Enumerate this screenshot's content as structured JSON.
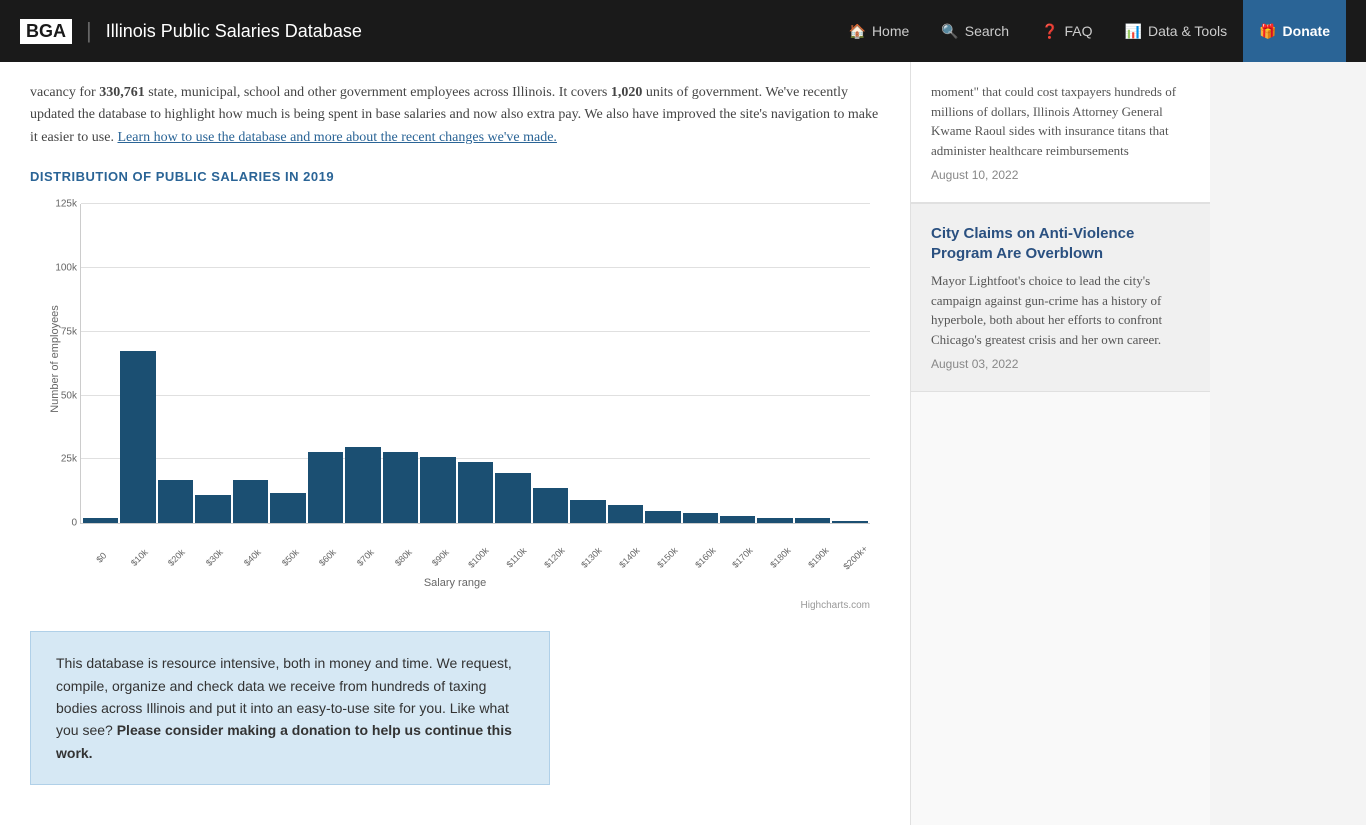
{
  "navbar": {
    "logo": "BGA",
    "divider": "|",
    "title": "Illinois Public Salaries Database",
    "nav_items": [
      {
        "label": "Home",
        "icon": "🏠"
      },
      {
        "label": "Search",
        "icon": "🔍"
      },
      {
        "label": "FAQ",
        "icon": "❓"
      },
      {
        "label": "Data & Tools",
        "icon": "📊"
      },
      {
        "label": "Donate",
        "icon": "🎁"
      }
    ]
  },
  "main": {
    "intro": "vacancy for 330,761 state, municipal, school and other government employees across Illinois. It covers 1,020 units of government. We've recently updated the database to highlight how much is being spent in base salaries and now also extra pay. We also have improved the site's navigation to make it easier to use.",
    "intro_link": "Learn how to use the database and more about the recent changes we've made.",
    "chart_title": "DISTRIBUTION OF PUBLIC SALARIES IN 2019",
    "x_axis_title": "Salary range",
    "y_axis_label": "Number of employees",
    "highcharts_credit": "Highcharts.com",
    "y_labels": [
      "0",
      "25k",
      "50k",
      "75k",
      "100k",
      "125k"
    ],
    "x_labels": [
      "$0",
      "$10k",
      "$20k",
      "$30k",
      "$40k",
      "$50k",
      "$60k",
      "$70k",
      "$80k",
      "$90k",
      "$100k",
      "$110k",
      "$120k",
      "$130k",
      "$140k",
      "$150k",
      "$160k",
      "$170k",
      "$180k",
      "$190k",
      "$200k+"
    ],
    "bar_heights_pct": [
      2,
      68,
      17,
      11,
      17,
      12,
      28,
      30,
      28,
      26,
      24,
      20,
      14,
      9,
      7,
      5,
      4,
      3,
      2,
      2,
      1
    ],
    "donation_box": {
      "text": "This database is resource intensive, both in money and time. We request, compile, organize and check data we receive from hundreds of taxing bodies across Illinois and put it into an easy-to-use site for you. Like what you see?",
      "bold": "Please consider making a donation to help us continue this work."
    }
  },
  "sidebar": {
    "articles": [
      {
        "title": "",
        "body": "moment\" that could cost taxpayers hundreds of millions of dollars, Illinois Attorney General Kwame Raoul sides with insurance titans that administer healthcare reimbursements",
        "date": "August 10, 2022"
      },
      {
        "title": "City Claims on Anti-Violence Program Are Overblown",
        "body": "Mayor Lightfoot's choice to lead the city's campaign against gun-crime has a history of hyperbole, both about her efforts to confront Chicago's greatest crisis and her own career.",
        "date": "August 03, 2022"
      }
    ]
  }
}
